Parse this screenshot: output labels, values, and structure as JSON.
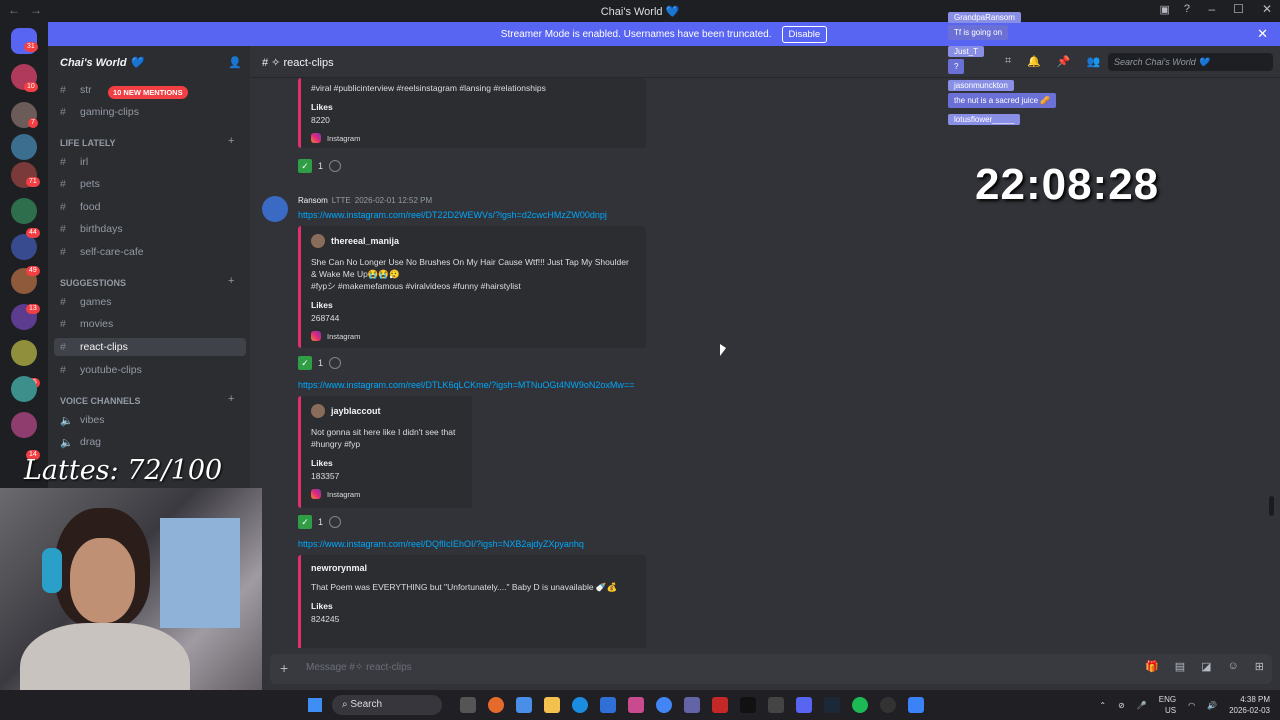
{
  "window": {
    "title": "Chai's World 💙"
  },
  "banner": {
    "text": "Streamer Mode is enabled. Usernames have been truncated.",
    "button": "Disable"
  },
  "server": {
    "name": "Chai's World 💙",
    "mentions_badge": "10 NEW MENTIONS"
  },
  "server_badges": [
    "31",
    "10",
    "7",
    "71",
    "44",
    "49",
    "13",
    "45",
    "14"
  ],
  "channels": {
    "top": [
      {
        "label": "str"
      },
      {
        "label": "gaming-clips"
      }
    ],
    "life_lately": {
      "label": "LIFE LATELY",
      "items": [
        "irl",
        "pets",
        "food",
        "birthdays",
        "self-care-cafe"
      ]
    },
    "suggestions": {
      "label": "SUGGESTIONS",
      "items": [
        "games",
        "movies",
        "react-clips",
        "youtube-clips"
      ]
    },
    "voice": {
      "label": "VOICE CHANNELS",
      "items": [
        "vibes",
        "drag"
      ]
    }
  },
  "overlay": {
    "lattes": "Lattes: 72/100",
    "clock": "22:08:28"
  },
  "header": {
    "channel": "react-clips",
    "search_placeholder": "Search Chai's World 💙"
  },
  "messages": {
    "embed0": {
      "desc": "#viral #publicinterview #reelsinstagram #lansing #relationships",
      "likes_label": "Likes",
      "likes": "8220",
      "source": "Instagram",
      "react_count": "1"
    },
    "msg1": {
      "author": "Ransom",
      "tag": "LTTE",
      "time": "2026-02-01 12:52 PM",
      "link": "https://www.instagram.com/reel/DT22D2WEWVs/?igsh=d2cwcHMzZW00dnpj",
      "embed_author": "thereeal_manija",
      "embed_desc": "She Can No Longer Use No Brushes On My Hair Cause Wtf!!! Just Tap My Shoulder & Wake Me Up😭😭😮‍💨",
      "embed_tags": "#fypシ #makemefamous #viralvideos #funny #hairstylist",
      "likes_label": "Likes",
      "likes": "268744",
      "source": "Instagram",
      "react_count": "1"
    },
    "msg2": {
      "link": "https://www.instagram.com/reel/DTLK6qLCKme/?igsh=MTNuOGt4NW9oN2oxMw==",
      "embed_author": "jayblaccout",
      "embed_desc": "Not gonna sit here like I didn't see that",
      "embed_tags": "#hungry #fyp",
      "likes_label": "Likes",
      "likes": "183357",
      "source": "Instagram",
      "react_count": "1"
    },
    "msg3": {
      "link": "https://www.instagram.com/reel/DQflIcIEhOI/?igsh=NXB2ajdyZXpyanhq",
      "embed_author": "newrorynmal",
      "embed_desc": "That Poem was EVERYTHING but \"Unfortunately....\" Baby D is unavailable 🍼💰",
      "likes_label": "Likes",
      "likes": "824245"
    }
  },
  "composer": {
    "placeholder": "Message #✧ react-clips"
  },
  "stream_chat": [
    {
      "user": "GrandpaRansom",
      "msg": "Tf is going on"
    },
    {
      "user": "Just_T",
      "msg": "?"
    },
    {
      "user": "jasonmunckton",
      "msg": "the nut is a sacred juice 🥜"
    },
    {
      "user": "lotusflower_____",
      "msg": ""
    }
  ],
  "taskbar": {
    "search": "Search",
    "lang": "ENG",
    "region": "US",
    "time": "4:38 PM",
    "date": "2026-02-03"
  }
}
